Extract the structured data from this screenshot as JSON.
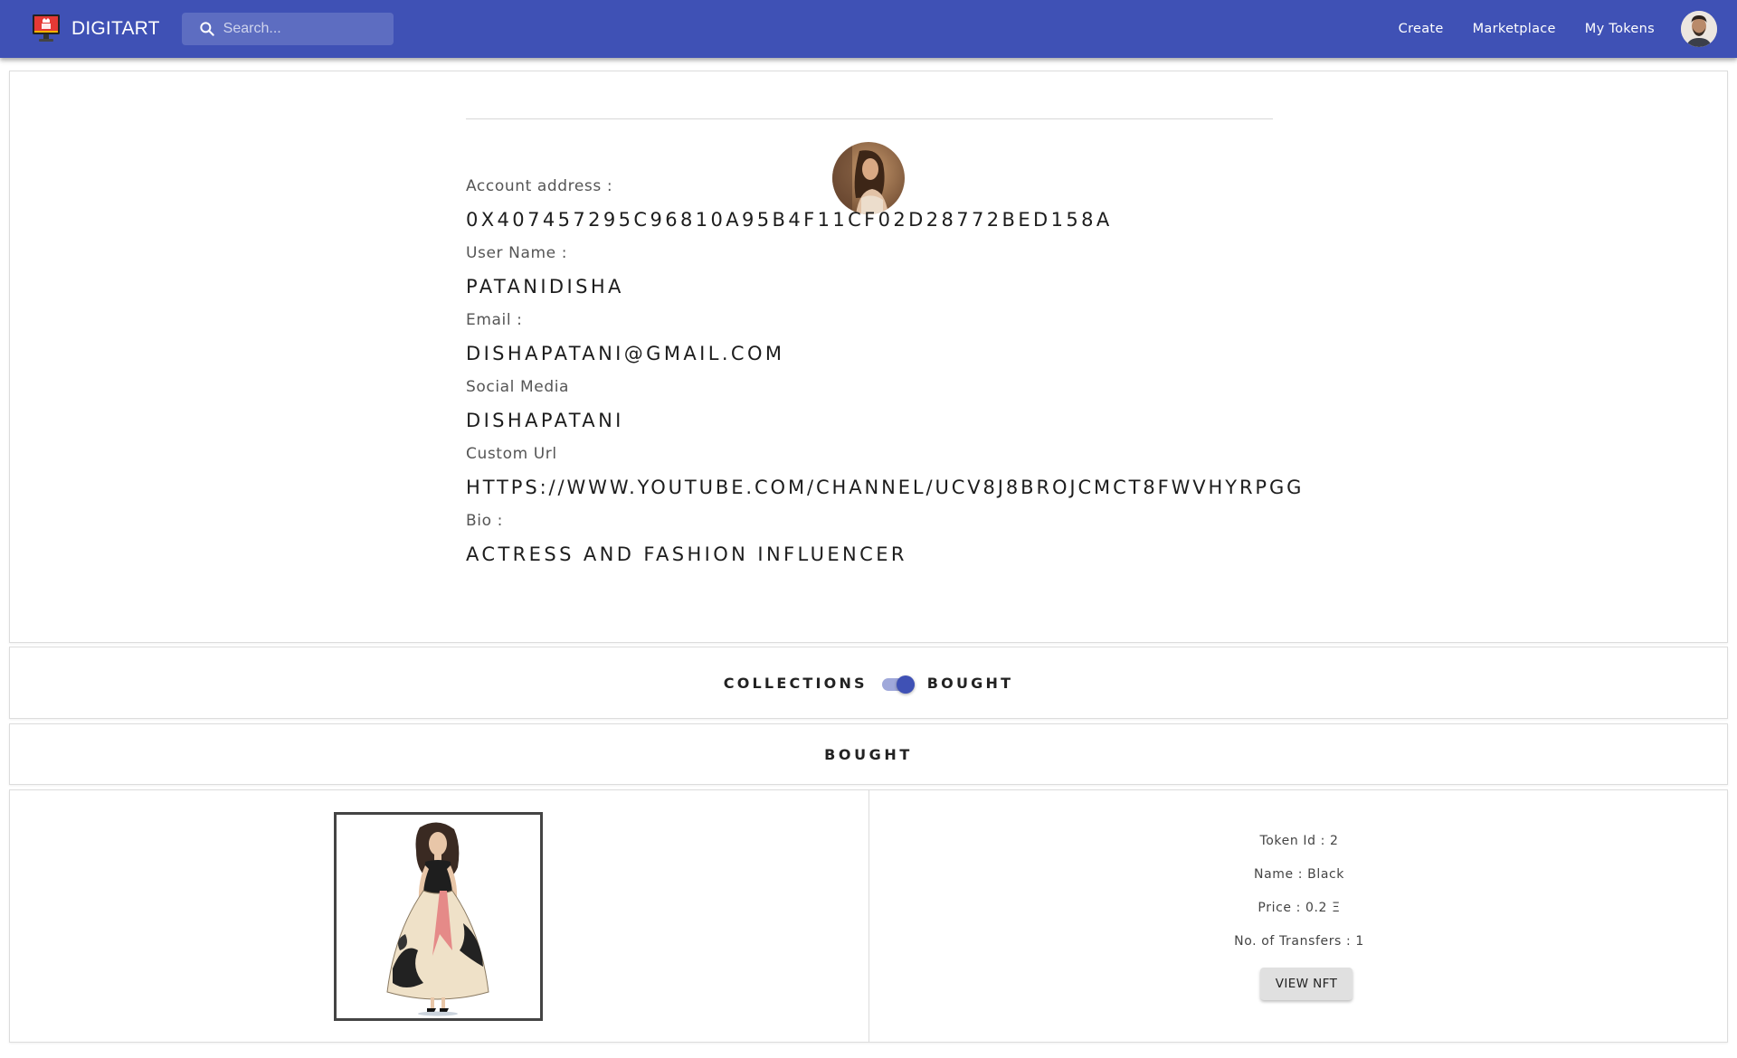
{
  "appbar": {
    "brand_name": "DIGITART",
    "search_placeholder": "Search...",
    "nav": [
      "Create",
      "Marketplace",
      "My Tokens"
    ]
  },
  "profile": {
    "fields": [
      {
        "label": "Account address :",
        "value": "0X407457295C96810A95B4F11CF02D28772BED158A"
      },
      {
        "label": "User Name :",
        "value": "PATANIDISHA"
      },
      {
        "label": "Email :",
        "value": "DISHAPATANI@GMAIL.COM"
      },
      {
        "label": "Social Media",
        "value": "DISHAPATANI"
      },
      {
        "label": "Custom Url",
        "value": "HTTPS://WWW.YOUTUBE.COM/CHANNEL/UCV8J8BROJCMCT8FWVHYRPGG"
      },
      {
        "label": "Bio :",
        "value": "ACTRESS AND FASHION INFLUENCER"
      }
    ]
  },
  "toggle": {
    "left_label": "COLLECTIONS",
    "right_label": "BOUGHT",
    "checked": true
  },
  "section_heading": "BOUGHT",
  "items": [
    {
      "token_id": "Token Id : 2",
      "name": "Name : Black",
      "price": "Price : 0.2 Ξ",
      "transfers": "No. of Transfers : 1",
      "button_label": "VIEW NFT"
    }
  ],
  "colors": {
    "primary": "#3f51b5",
    "toggle_track": "#9fa8da",
    "button_bg": "#e0e0e0"
  }
}
